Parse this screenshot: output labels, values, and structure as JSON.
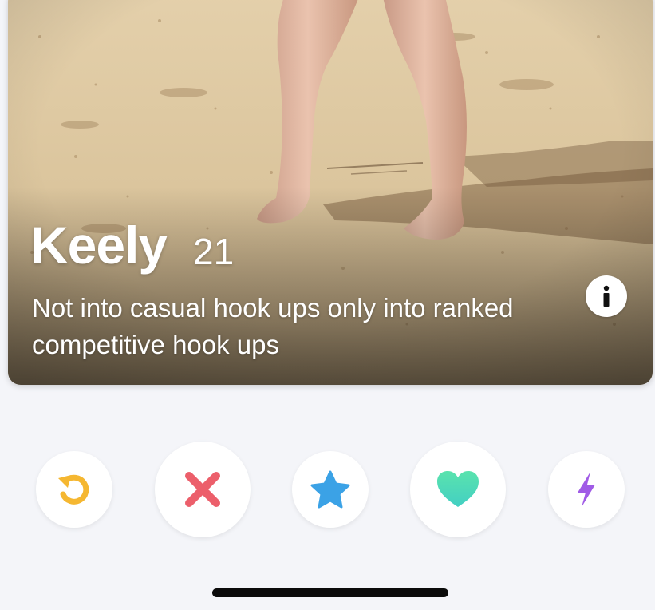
{
  "profile": {
    "name": "Keely",
    "age": "21",
    "bio": "Not into casual hook ups only into ranked competitive hook ups"
  },
  "card": {
    "photo_subject": "legs standing on sand at a beach",
    "info_icon": "info-icon"
  },
  "actions": [
    {
      "name": "rewind",
      "icon": "rewind-icon",
      "color": "#f5b731"
    },
    {
      "name": "nope",
      "icon": "x-icon",
      "color": "#ec5f6b"
    },
    {
      "name": "super-like",
      "icon": "star-icon",
      "color": "#3ba2e6"
    },
    {
      "name": "like",
      "icon": "heart-icon",
      "color": "#4fd9b0"
    },
    {
      "name": "boost",
      "icon": "lightning-icon",
      "color": "#a05be6"
    }
  ],
  "colors": {
    "background": "#f4f5f9",
    "sand": "#dcc7a2",
    "text_on_photo": "#ffffff"
  }
}
